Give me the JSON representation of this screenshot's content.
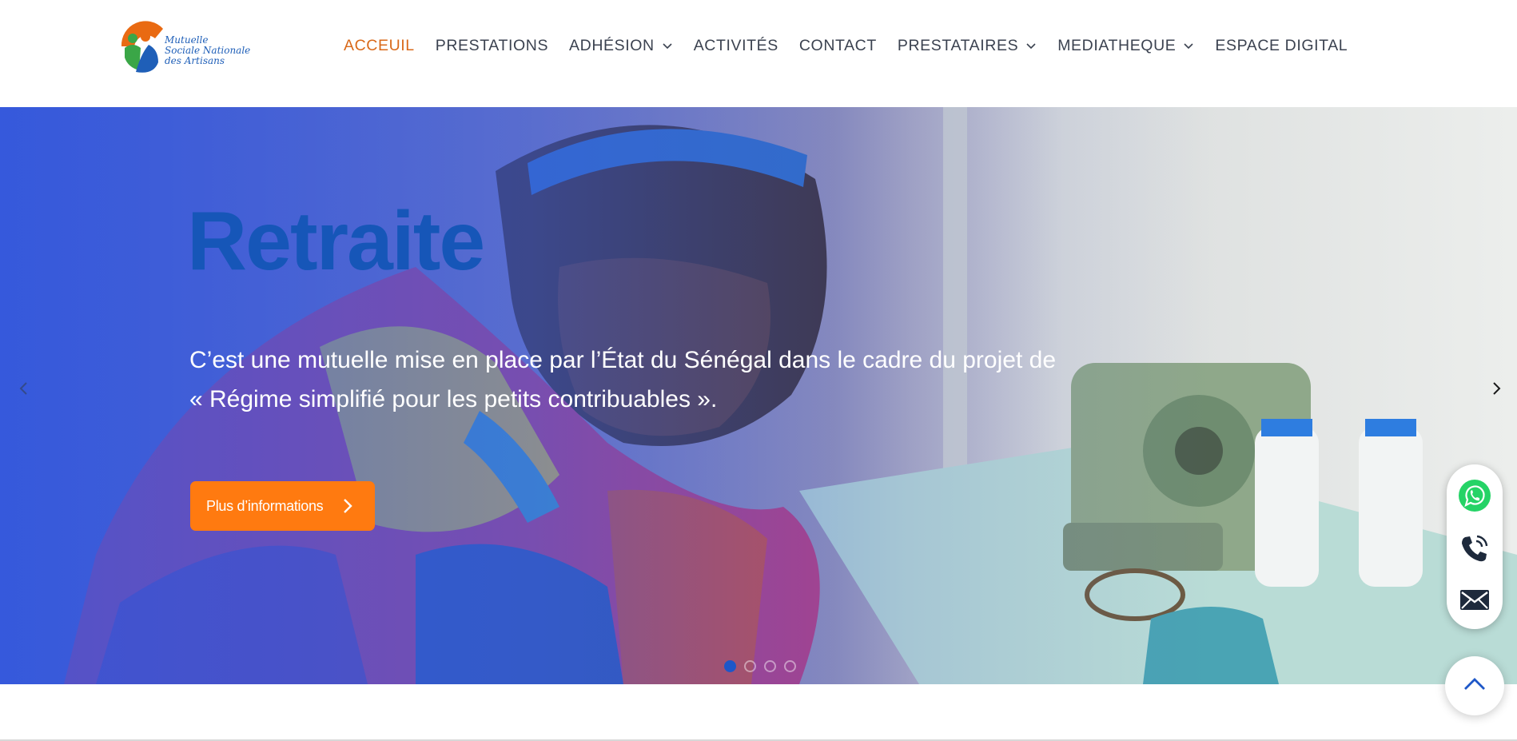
{
  "brand": {
    "logo_lines": [
      "Mutuelle",
      "Sociale Nationale",
      "des Artisans"
    ],
    "logo_colors": {
      "orange": "#e96a12",
      "green": "#3aa647",
      "blue": "#1f5fb8"
    }
  },
  "nav": {
    "items": [
      {
        "label": "ACCEUIL",
        "active": true,
        "has_dropdown": false
      },
      {
        "label": "PRESTATIONS",
        "active": false,
        "has_dropdown": false
      },
      {
        "label": "ADHÉSION",
        "active": false,
        "has_dropdown": true
      },
      {
        "label": "ACTIVITÉS",
        "active": false,
        "has_dropdown": false
      },
      {
        "label": "CONTACT",
        "active": false,
        "has_dropdown": false
      },
      {
        "label": "PRESTATAIRES",
        "active": false,
        "has_dropdown": true
      },
      {
        "label": "MEDIATHEQUE",
        "active": false,
        "has_dropdown": true
      },
      {
        "label": "ESPACE DIGITAL",
        "active": false,
        "has_dropdown": false
      }
    ],
    "active_color": "#d9691a",
    "text_color": "#3b4250"
  },
  "hero": {
    "title": "Retraite",
    "text_lines": [
      "C’est une mutuelle mise en place par l’État du Sénégal dans le cadre du projet de",
      "« Régime simplifié pour les petits contribuables »."
    ],
    "cta_label": "Plus d’informations",
    "cta_icon": "chevron-right-icon",
    "prev_icon": "chevron-left-icon",
    "next_icon": "chevron-right-icon",
    "slide_count": 4,
    "active_slide": 1,
    "title_color": "#1656b8",
    "cta_color": "#ff7a10"
  },
  "contact_widget": {
    "buttons": [
      "whatsapp-icon",
      "phone-icon",
      "mail-icon"
    ],
    "whatsapp_color": "#25d366",
    "icon_color": "#1e2a3c"
  },
  "scroll_top": {
    "icon": "chevron-up-icon",
    "color": "#1e57c8"
  }
}
